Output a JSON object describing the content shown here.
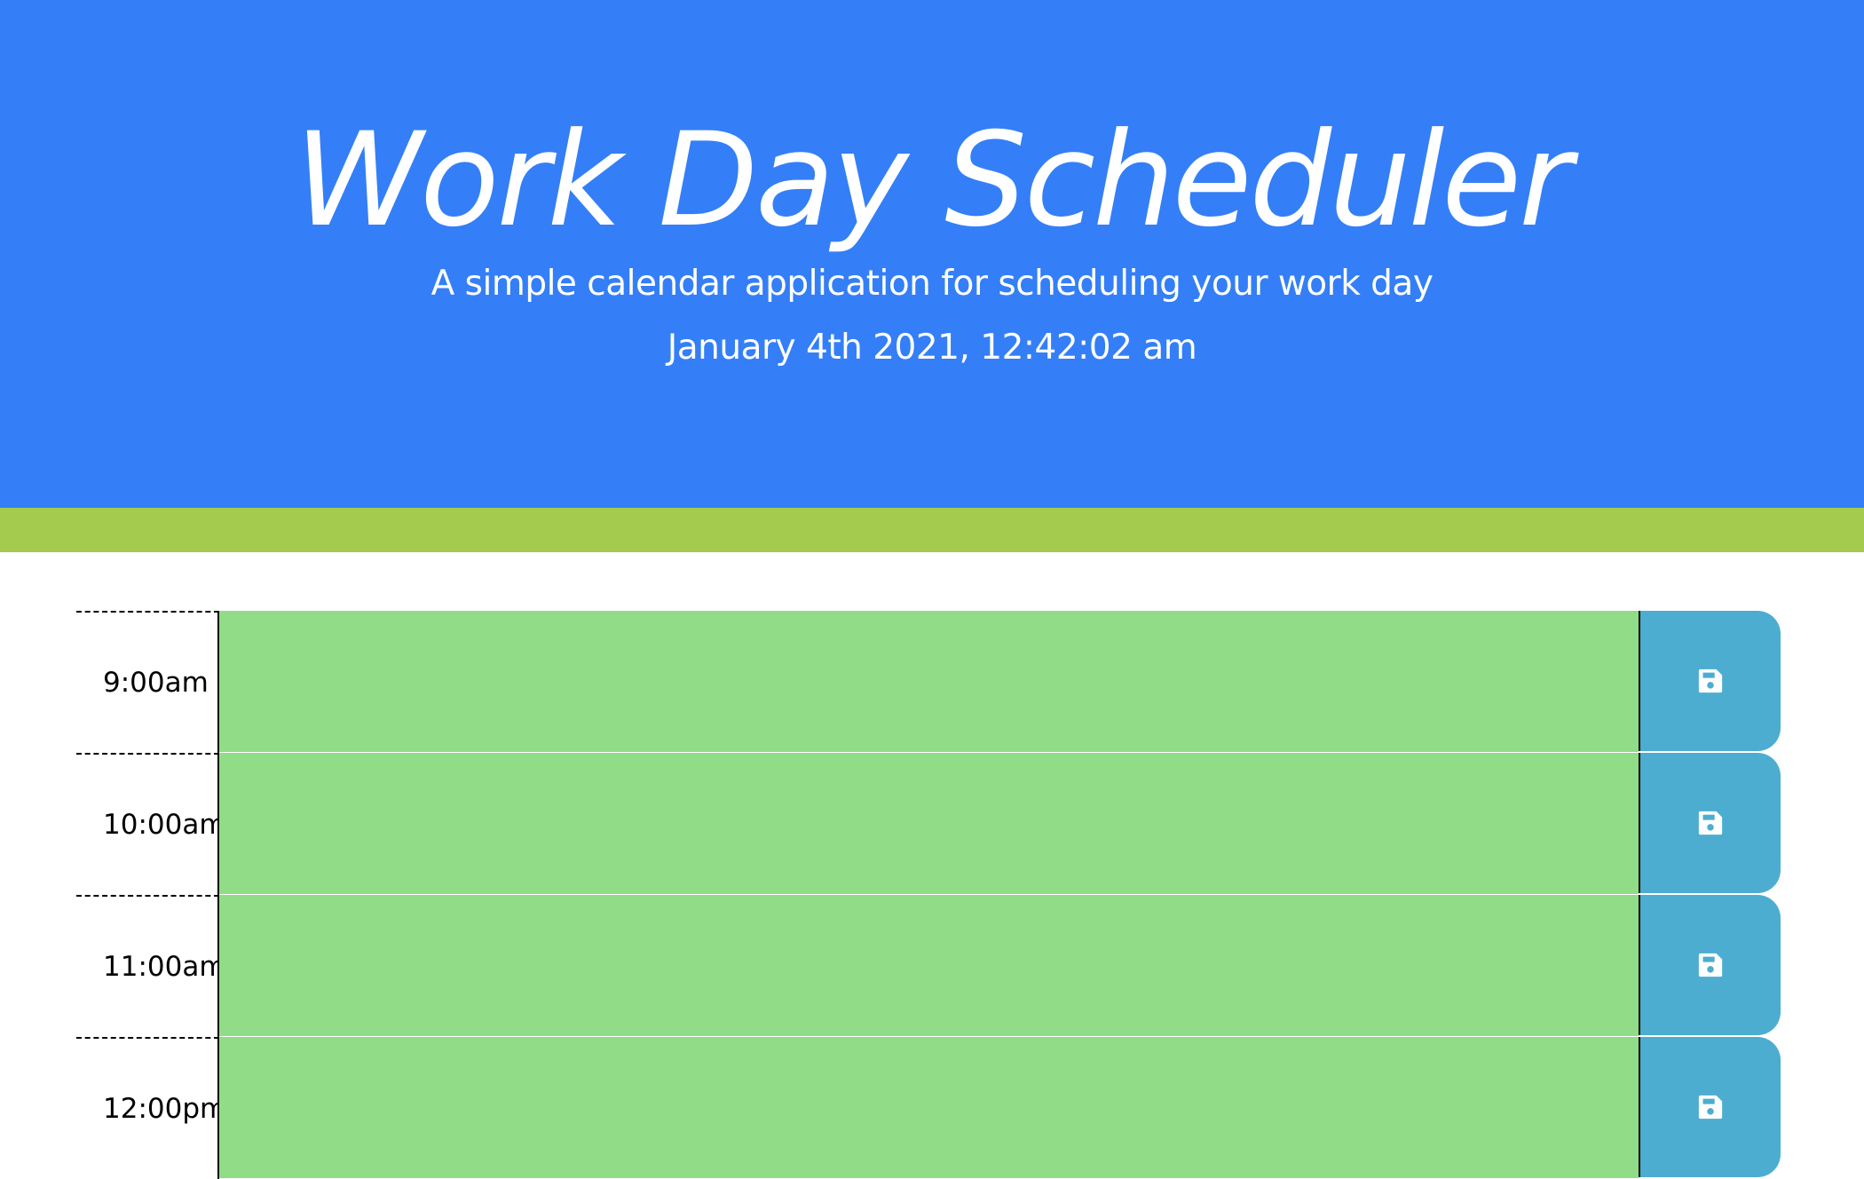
{
  "header": {
    "title": "Work Day Scheduler",
    "lead": "A simple calendar application for scheduling your work day",
    "current_day": "January 4th 2021, 12:42:02 am"
  },
  "colors": {
    "header_bg": "#347ff7",
    "divider": "#a4cb4d",
    "future_block": "#91dc86",
    "save_button": "#4cadd1"
  },
  "time_blocks": [
    {
      "hour": "9:00am",
      "text": "",
      "state": "future",
      "icon": "save-icon"
    },
    {
      "hour": "10:00am",
      "text": "",
      "state": "future",
      "icon": "save-icon"
    },
    {
      "hour": "11:00am",
      "text": "",
      "state": "future",
      "icon": "save-icon"
    },
    {
      "hour": "12:00pm",
      "text": "",
      "state": "future",
      "icon": "save-icon"
    }
  ]
}
